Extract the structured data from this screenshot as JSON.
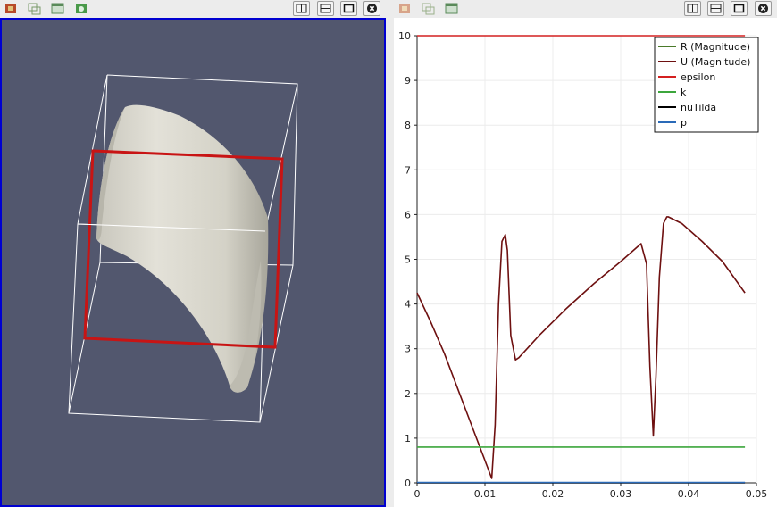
{
  "left_toolbar": {
    "buttons": [
      {
        "icon": "camera-reset-icon"
      },
      {
        "icon": "select-icon"
      },
      {
        "icon": "frame-icon"
      },
      {
        "icon": "camera-link-icon"
      }
    ],
    "window_buttons": [
      {
        "icon": "split-horizontal-icon"
      },
      {
        "icon": "split-vertical-icon"
      },
      {
        "icon": "maximize-icon"
      },
      {
        "icon": "close-icon"
      }
    ]
  },
  "right_toolbar": {
    "buttons": [
      {
        "icon": "camera-reset-icon"
      },
      {
        "icon": "select-icon"
      },
      {
        "icon": "frame-icon"
      }
    ],
    "window_buttons": [
      {
        "icon": "split-horizontal-icon"
      },
      {
        "icon": "split-vertical-icon"
      },
      {
        "icon": "maximize-icon"
      },
      {
        "icon": "close-icon"
      }
    ]
  },
  "render_view": {
    "background": "#52576e",
    "active_border_color": "#0000d0",
    "surface_color": "#dcdad0",
    "outline_color": "#ffffff",
    "slice_color": "#c81414"
  },
  "chart_data": {
    "type": "line",
    "xlim": [
      0,
      0.05
    ],
    "ylim": [
      0,
      10
    ],
    "x_ticks": [
      "0",
      "0.01",
      "0.02",
      "0.03",
      "0.04",
      "0.05"
    ],
    "y_ticks": [
      "0",
      "1",
      "2",
      "3",
      "4",
      "5",
      "6",
      "7",
      "8",
      "9",
      "10"
    ],
    "grid": true,
    "legend_position": "top-right",
    "series": [
      {
        "name": "R (Magnitude)",
        "color": "#4a7a2a",
        "x": [],
        "y": []
      },
      {
        "name": "U (Magnitude)",
        "color": "#6e1010",
        "x": [
          0,
          0.002,
          0.004,
          0.006,
          0.008,
          0.01,
          0.011,
          0.0115,
          0.012,
          0.0125,
          0.013,
          0.0133,
          0.0138,
          0.0145,
          0.015,
          0.018,
          0.022,
          0.026,
          0.03,
          0.033,
          0.0338,
          0.0343,
          0.0348,
          0.0352,
          0.0357,
          0.0363,
          0.0368,
          0.037,
          0.039,
          0.042,
          0.045,
          0.0483
        ],
        "y": [
          4.25,
          3.6,
          2.9,
          2.1,
          1.3,
          0.5,
          0.1,
          1.3,
          4.0,
          5.4,
          5.55,
          5.2,
          3.3,
          2.75,
          2.8,
          3.3,
          3.9,
          4.45,
          4.95,
          5.35,
          4.9,
          2.6,
          1.05,
          2.4,
          4.6,
          5.8,
          5.95,
          5.95,
          5.8,
          5.4,
          4.95,
          4.25
        ]
      },
      {
        "name": "epsilon",
        "color": "#d42020",
        "x": [
          0,
          0.0483
        ],
        "y": [
          10,
          10
        ]
      },
      {
        "name": "k",
        "color": "#3ca63c",
        "x": [
          0,
          0.0483
        ],
        "y": [
          0.8,
          0.8
        ]
      },
      {
        "name": "nuTilda",
        "color": "#000000",
        "x": [
          0,
          0.0483
        ],
        "y": [
          0,
          0
        ]
      },
      {
        "name": "p",
        "color": "#2a6ab8",
        "x": [
          0,
          0.0483
        ],
        "y": [
          0.01,
          0.01
        ]
      }
    ]
  }
}
